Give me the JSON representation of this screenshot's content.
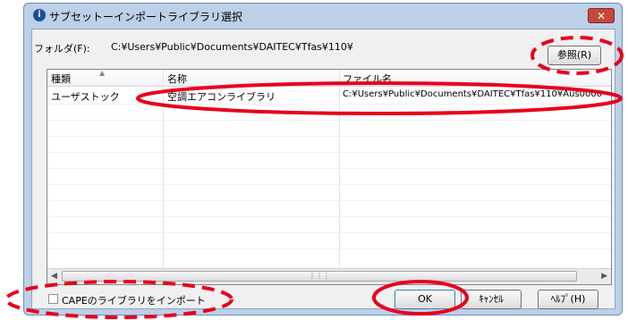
{
  "window": {
    "title": "サブセットーインポートライブラリ選択",
    "close_label": "✕"
  },
  "folder": {
    "label": "フォルダ(F):",
    "path": "C:¥Users¥Public¥Documents¥DAITEC¥Tfas¥110¥",
    "browse_label": "参照(R)"
  },
  "list": {
    "columns": [
      "種類",
      "名称",
      "ファイル名"
    ],
    "rows": [
      {
        "type": "ユーザストック",
        "name": "空調エアコンライブラリ",
        "file": "C:¥Users¥Public¥Documents¥DAITEC¥Tfas¥110¥Aus0000"
      }
    ]
  },
  "footer": {
    "cape_checkbox_label": "CAPEのライブラリをインポート",
    "cape_checked": false,
    "ok_label": "OK",
    "cancel_label": "ｷｬﾝｾﾙ",
    "help_label": "ﾍﾙﾌﾟ(H)"
  },
  "annotation": {
    "color": "#e8001c"
  }
}
